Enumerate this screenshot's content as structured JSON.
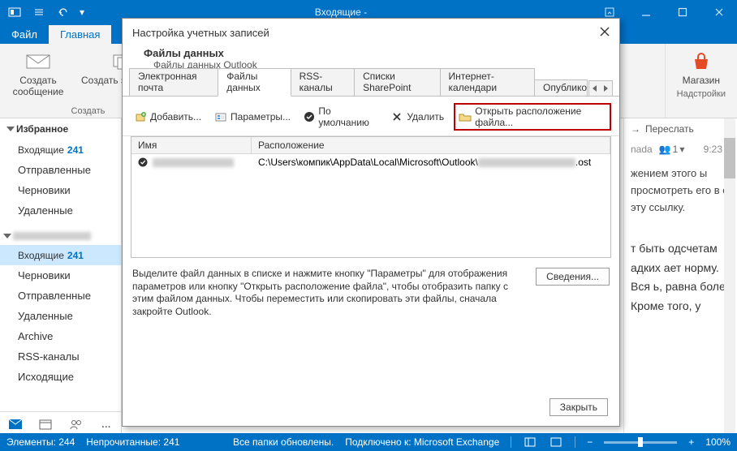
{
  "titlebar": {
    "title": "Входящие -"
  },
  "menu": {
    "file": "Файл",
    "home": "Главная"
  },
  "ribbon": {
    "new_mail": "Создать сообщение",
    "new_item": "Создать элемент",
    "group_create": "Создать",
    "store": "Магазин",
    "group_addins": "Надстройки"
  },
  "nav": {
    "favorites": "Избранное",
    "inbox": "Входящие",
    "inbox_count": "241",
    "sent": "Отправленные",
    "drafts": "Черновики",
    "deleted": "Удаленные",
    "acct_inbox": "Входящие",
    "acct_inbox_count": "241",
    "acct_drafts": "Черновики",
    "acct_sent": "Отправленные",
    "acct_deleted": "Удаленные",
    "archive": "Archive",
    "rss": "RSS-каналы",
    "outbox": "Исходящие",
    "more": "…"
  },
  "reading": {
    "forward": "Переслать",
    "from": "nada",
    "people": "1",
    "time": "9:23",
    "p1": "жением этого ы просмотреть его в е эту ссылку.",
    "p2": "т быть одсчетам адких ает норму. Вся ь, равна более Кроме того, у"
  },
  "status": {
    "items": "Элементы: 244",
    "unread": "Непрочитанные: 241",
    "synced": "Все папки обновлены.",
    "connected": "Подключено к: Microsoft Exchange",
    "zoom_minus": "−",
    "zoom_plus": "+",
    "zoom": "100%"
  },
  "dialog": {
    "title": "Настройка учетных записей",
    "sub_h": "Файлы данных",
    "sub_s": "Файлы данных Outlook",
    "tabs": {
      "email": "Электронная почта",
      "data": "Файлы данных",
      "rss": "RSS-каналы",
      "sp": "Списки SharePoint",
      "ical": "Интернет-календари",
      "pub": "Опублико"
    },
    "toolbar": {
      "add": "Добавить...",
      "params": "Параметры...",
      "default": "По умолчанию",
      "remove": "Удалить",
      "open": "Открыть расположение файла..."
    },
    "list": {
      "col_name": "Имя",
      "col_loc": "Расположение",
      "row_loc_pre": "C:\\Users\\компик\\AppData\\Local\\Microsoft\\Outlook\\",
      "row_loc_ext": ".ost"
    },
    "help": "Выделите файл данных в списке и нажмите кнопку \"Параметры\" для отображения параметров или кнопку \"Открыть расположение файла\", чтобы отобразить папку с этим файлом данных. Чтобы переместить или скопировать эти файлы, сначала закройте Outlook.",
    "details": "Сведения...",
    "close": "Закрыть"
  }
}
